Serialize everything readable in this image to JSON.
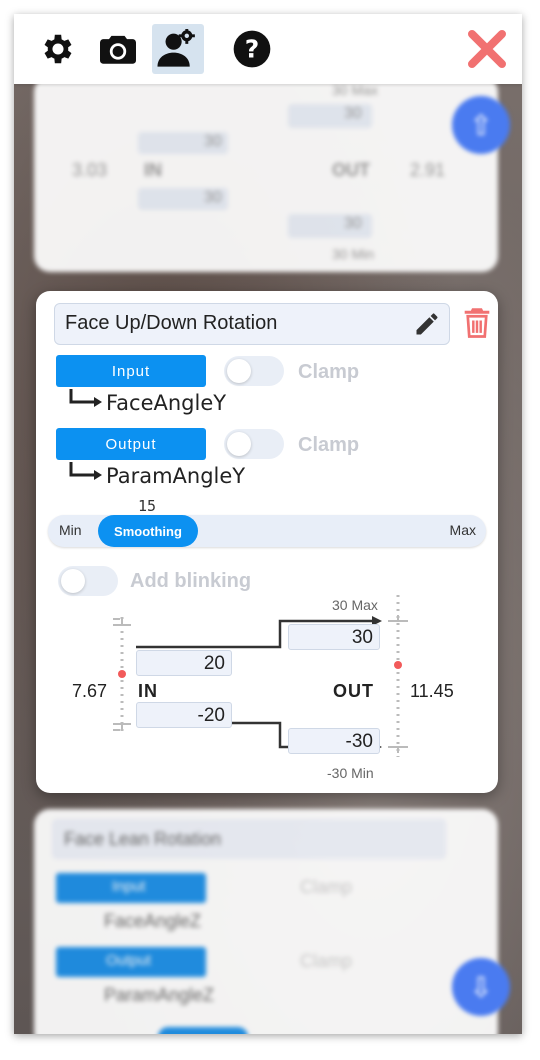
{
  "toolbar": {
    "icons": [
      "gear-icon",
      "camera-icon",
      "user-settings-icon",
      "help-icon",
      "close-icon"
    ],
    "active": "user-settings-icon",
    "close_color": "#f17171"
  },
  "background_cards": {
    "top": {
      "max_label": "30 Max",
      "min_label": "30 Min",
      "in_value": "3.03",
      "out_value": "2.91",
      "in_label": "IN",
      "out_label": "OUT",
      "out_max": "30",
      "in_top": "30",
      "in_bottom": "30",
      "out_min": "30"
    },
    "bottom": {
      "title": "Face Lean Rotation",
      "input_label": "Input",
      "input_param": "FaceAngleZ",
      "output_label": "Output",
      "output_param": "ParamAngleZ",
      "clamp_label": "Clamp"
    }
  },
  "card": {
    "title": "Face Up/Down Rotation",
    "input": {
      "button_label": "Input",
      "clamp_label": "Clamp",
      "param": "FaceAngleY"
    },
    "output": {
      "button_label": "Output",
      "clamp_label": "Clamp",
      "param": "ParamAngleY"
    },
    "smoothing": {
      "label": "Smoothing",
      "value": "15",
      "min_label": "Min",
      "max_label": "Max"
    },
    "blinking": {
      "label": "Add blinking"
    },
    "mapping": {
      "in_label": "IN",
      "out_label": "OUT",
      "in_current": "7.67",
      "out_current": "11.45",
      "in_max": "20",
      "in_min": "-20",
      "out_max": "30",
      "out_min": "-30",
      "out_max_label": "30 Max",
      "out_min_label": "-30 Min"
    }
  },
  "colors": {
    "accent": "#0c91f1",
    "danger": "#f17171",
    "indicator": "#f25a5a",
    "fab": "#4a7bf0"
  }
}
